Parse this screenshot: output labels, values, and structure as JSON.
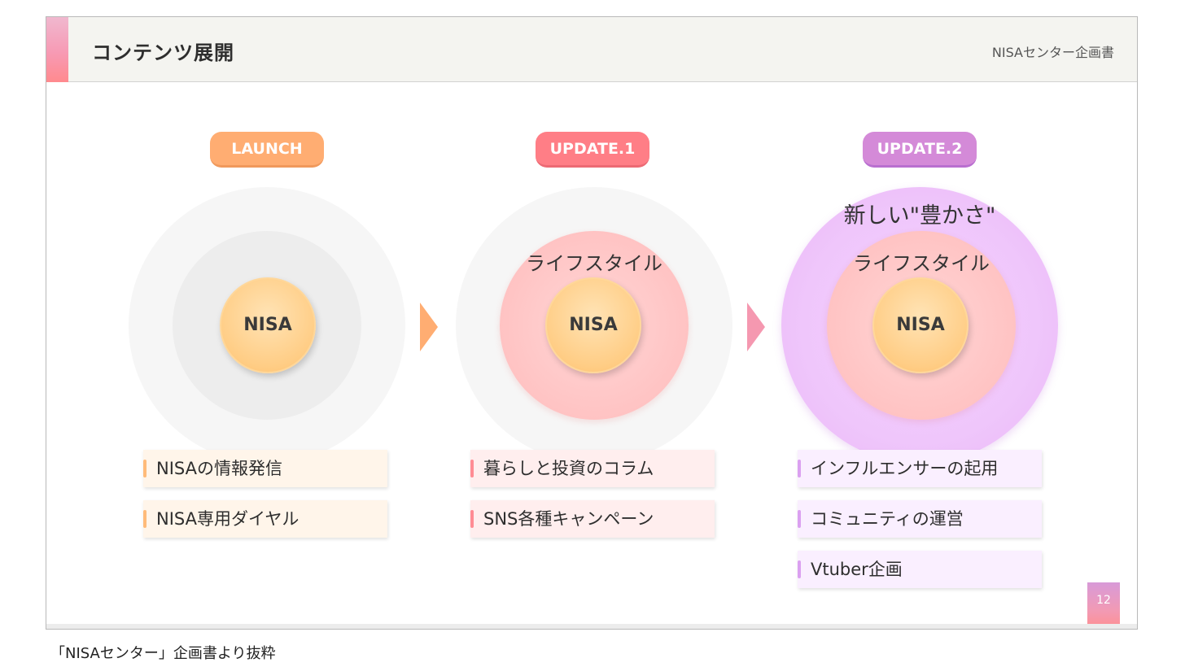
{
  "header": {
    "title": "コンテンツ展開",
    "doc_name": "NISAセンター企画書"
  },
  "stages": [
    {
      "badge": "LAUNCH",
      "core": "NISA",
      "items": [
        "NISAの情報発信",
        "NISA専用ダイヤル"
      ]
    },
    {
      "badge": "UPDATE.1",
      "core": "NISA",
      "middle_label": "ライフスタイル",
      "items": [
        "暮らしと投資のコラム",
        "SNS各種キャンペーン"
      ]
    },
    {
      "badge": "UPDATE.2",
      "core": "NISA",
      "middle_label": "ライフスタイル",
      "outer_label": "新しい\"豊かさ\"",
      "items": [
        "インフルエンサーの起用",
        "コミュニティの運営",
        "Vtuber企画"
      ]
    }
  ],
  "page_number": "12",
  "caption": "「NISAセンター」企画書より抜粋",
  "colors": {
    "launch": "#ffad72",
    "update1": "#ff7e86",
    "update2": "#d48ad8",
    "core": "#ffcd85"
  }
}
